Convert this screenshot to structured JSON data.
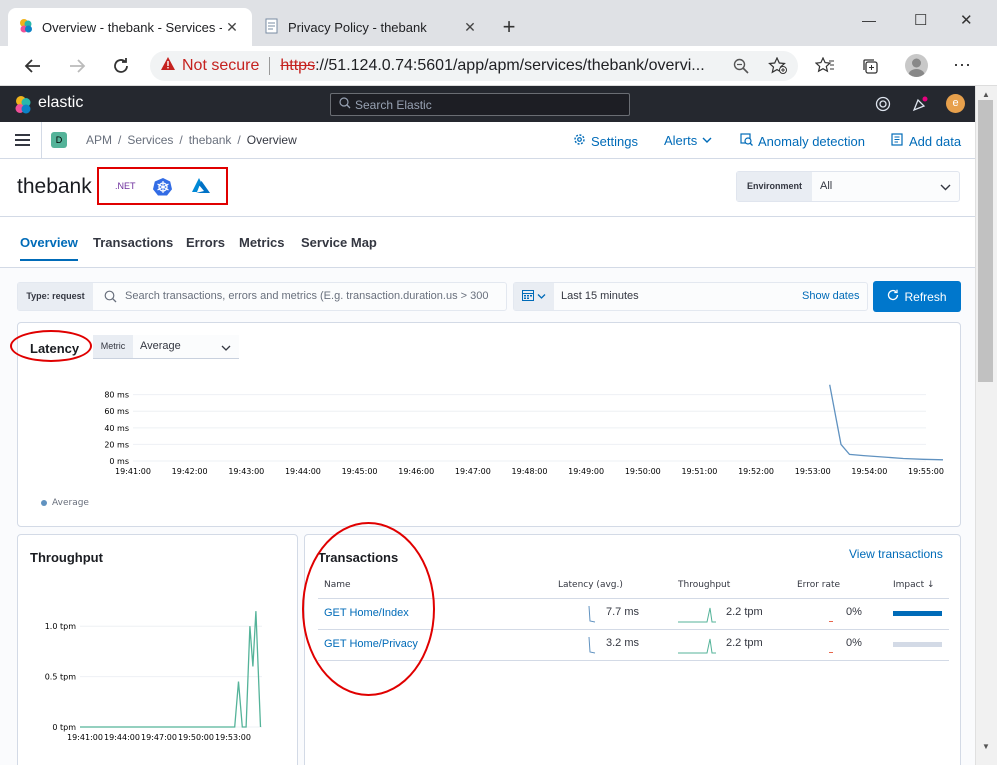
{
  "browser": {
    "tabs": [
      {
        "title": "Overview - thebank - Services - A",
        "close": "✕"
      },
      {
        "title": "Privacy Policy - thebank",
        "close": "✕"
      }
    ],
    "new_tab": "+",
    "window_controls": {
      "min": "—",
      "max": "☐",
      "close": "✕"
    },
    "not_secure": "Not secure",
    "url_scheme": "https",
    "url_rest": "://51.124.0.74:5601/app/apm/services/thebank/overvi..."
  },
  "kibana": {
    "brand": "elastic",
    "search_placeholder": "Search Elastic",
    "avatar_letter": "e",
    "space_letter": "D",
    "breadcrumbs": [
      "APM",
      "Services",
      "thebank",
      "Overview"
    ],
    "breadcrumb_sep": "/",
    "top_links": {
      "settings": "Settings",
      "alerts": "Alerts",
      "anomaly": "Anomaly detection",
      "add_data": "Add data"
    }
  },
  "service": {
    "name": "thebank",
    "badges": {
      "dotnet": ".NET"
    },
    "environment_label": "Environment",
    "environment_value": "All"
  },
  "tabs": [
    "Overview",
    "Transactions",
    "Errors",
    "Metrics",
    "Service Map"
  ],
  "query": {
    "type_label": "Type: request",
    "search_placeholder": "Search transactions, errors and metrics (E.g. transaction.duration.us > 300",
    "time_range": "Last 15 minutes",
    "show_dates": "Show dates",
    "refresh": "Refresh"
  },
  "latency": {
    "title": "Latency",
    "metric_label": "Metric",
    "metric_value": "Average",
    "legend": "Average"
  },
  "throughput": {
    "title": "Throughput"
  },
  "transactions": {
    "title": "Transactions",
    "view_link": "View transactions",
    "columns": {
      "name": "Name",
      "latency": "Latency (avg.)",
      "throughput": "Throughput",
      "error_rate": "Error rate",
      "impact": "Impact ↓"
    },
    "rows": [
      {
        "name": "GET Home/Index",
        "latency": "7.7 ms",
        "throughput": "2.2 tpm",
        "error_rate": "0%",
        "impact": 1.0
      },
      {
        "name": "GET Home/Privacy",
        "latency": "3.2 ms",
        "throughput": "2.2 tpm",
        "error_rate": "0%",
        "impact": 0.0
      }
    ]
  },
  "colors": {
    "link": "#006bb8",
    "latency_line": "#6092c0",
    "throughput_line": "#54b399",
    "annotation": "#e00000",
    "refresh_bg": "#0077cc"
  },
  "chart_data": [
    {
      "type": "line",
      "title": "Latency",
      "x": [
        "19:41:00",
        "19:42:00",
        "19:43:00",
        "19:44:00",
        "19:45:00",
        "19:46:00",
        "19:47:00",
        "19:48:00",
        "19:49:00",
        "19:50:00",
        "19:51:00",
        "19:52:00",
        "19:53:00",
        "19:54:00",
        "19:55:00"
      ],
      "yticks": [
        "0 ms",
        "20 ms",
        "40 ms",
        "60 ms",
        "80 ms"
      ],
      "ylim": [
        0,
        88
      ],
      "series": [
        {
          "name": "Average",
          "points": [
            [
              12.3,
              92
            ],
            [
              12.5,
              20
            ],
            [
              12.65,
              8
            ],
            [
              12.9,
              6.5
            ],
            [
              13.6,
              3
            ],
            [
              13.95,
              2
            ],
            [
              14.3,
              1.5
            ]
          ]
        }
      ]
    },
    {
      "type": "line",
      "title": "Throughput",
      "x": [
        "19:41:00",
        "19:44:00",
        "19:47:00",
        "19:50:00",
        "19:53:00"
      ],
      "yticks": [
        "0 tpm",
        "0.5 tpm",
        "1.0 tpm"
      ],
      "ylim": [
        0,
        1.25
      ],
      "series": [
        {
          "name": "",
          "points": [
            [
              0,
              0
            ],
            [
              10.2,
              0
            ],
            [
              10.45,
              0.45
            ],
            [
              10.7,
              0
            ],
            [
              10.95,
              0
            ],
            [
              11.2,
              1.0
            ],
            [
              11.4,
              0.6
            ],
            [
              11.6,
              1.15
            ],
            [
              11.9,
              0
            ]
          ]
        }
      ]
    }
  ]
}
